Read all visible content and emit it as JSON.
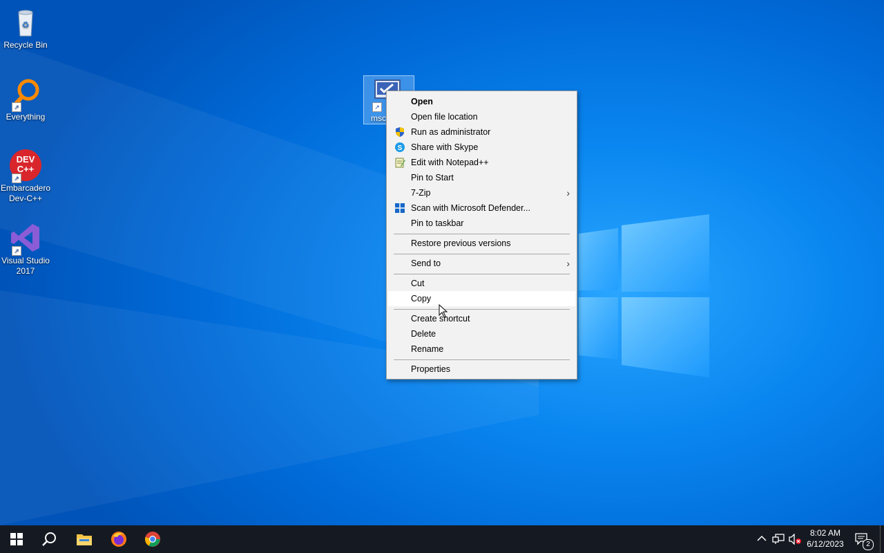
{
  "desktop": {
    "icons": [
      {
        "label": "Recycle Bin"
      },
      {
        "label": "Everything"
      },
      {
        "label": "Embarcadero Dev-C++",
        "logo_text": "DEV C++"
      },
      {
        "label": "Visual Studio 2017"
      }
    ],
    "selected_file_label": "msc"
  },
  "context_menu": {
    "items": [
      {
        "label": "Open"
      },
      {
        "label": "Open file location"
      },
      {
        "label": "Run as administrator"
      },
      {
        "label": "Share with Skype"
      },
      {
        "label": "Edit with Notepad++"
      },
      {
        "label": "Pin to Start"
      },
      {
        "label": "7-Zip"
      },
      {
        "label": "Scan with Microsoft Defender..."
      },
      {
        "label": "Pin to taskbar"
      },
      {
        "label": "Restore previous versions"
      },
      {
        "label": "Send to"
      },
      {
        "label": "Cut"
      },
      {
        "label": "Copy"
      },
      {
        "label": "Create shortcut"
      },
      {
        "label": "Delete"
      },
      {
        "label": "Rename"
      },
      {
        "label": "Properties"
      }
    ],
    "hovered": "Copy"
  },
  "taskbar": {
    "clock_time": "8:02 AM",
    "clock_date": "6/12/2023",
    "notification_count": "2"
  },
  "colors": {
    "accent": "#0a86f0",
    "taskbar": "#151a22",
    "menu_bg": "#f2f2f2"
  }
}
